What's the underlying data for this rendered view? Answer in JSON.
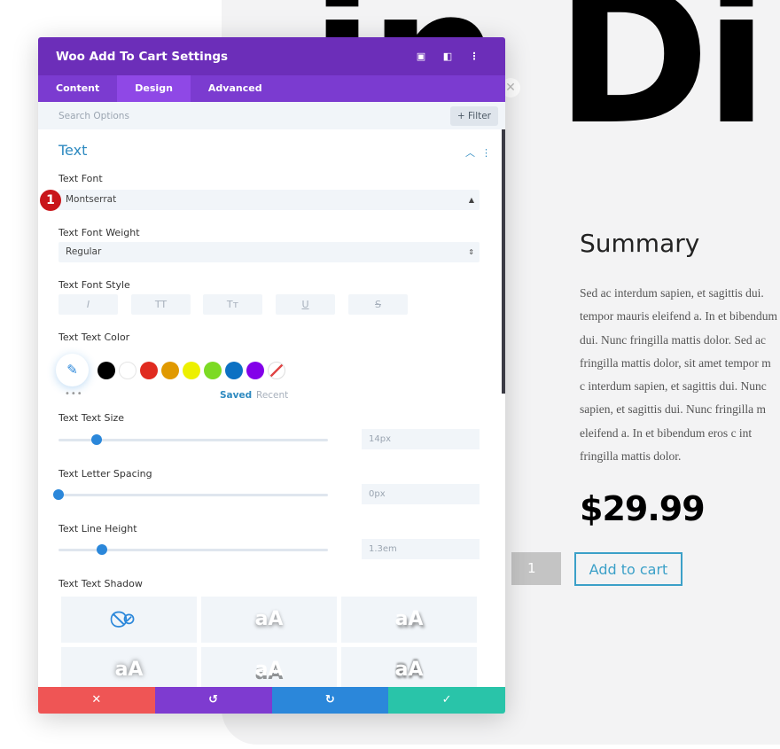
{
  "page": {
    "heading_fragment": "in Di",
    "summary_title": "Summary",
    "description_lines": [
      "Sed ac interdum sapien, et sagittis dui.",
      "tempor mauris eleifend a. In et bibendum",
      "dui. Nunc fringilla mattis dolor. Sed ac",
      "fringilla mattis dolor, sit amet tempor m",
      "c interdum sapien, et sagittis dui. Nunc",
      "sapien, et sagittis dui. Nunc fringilla m",
      "eleifend a. In et bibendum eros c int",
      "fringilla mattis dolor."
    ],
    "price": "$29.99",
    "quantity": "1",
    "add_to_cart": "Add to cart"
  },
  "modal": {
    "title": "Woo Add To Cart Settings",
    "header_icons": [
      "fullscreen-icon",
      "split-view-icon",
      "more-vertical-icon"
    ],
    "tabs": [
      {
        "label": "Content"
      },
      {
        "label": "Design",
        "active": true
      },
      {
        "label": "Advanced"
      }
    ],
    "search_placeholder": "Search Options",
    "filter_label": "+ Filter",
    "section": "Text",
    "text_font": {
      "label": "Text Font",
      "value": "Montserrat",
      "badge": "1"
    },
    "font_weight": {
      "label": "Text Font Weight",
      "value": "Regular"
    },
    "font_style": {
      "label": "Text Font Style",
      "buttons": [
        "I",
        "TT",
        "Tт",
        "U",
        "S"
      ]
    },
    "text_color": {
      "label": "Text Text Color",
      "swatches": [
        "#000000",
        "#ffffff",
        "#e02b20",
        "#e09900",
        "#edf000",
        "#7cda24",
        "#0c71c3",
        "#8300e9"
      ],
      "saved": "Saved",
      "recent": "Recent"
    },
    "text_size": {
      "label": "Text Text Size",
      "value": "14px",
      "percent": 14
    },
    "letter_spacing": {
      "label": "Text Letter Spacing",
      "value": "0px",
      "percent": 0
    },
    "line_height": {
      "label": "Text Line Height",
      "value": "1.3em",
      "percent": 16
    },
    "text_shadow": {
      "label": "Text Text Shadow",
      "options": [
        "none",
        "aA",
        "aA",
        "aA",
        "aA",
        "aA"
      ]
    },
    "footer": {
      "colors": [
        "#ef5555",
        "#7e3bd0",
        "#2b87da",
        "#29c4a9"
      ]
    }
  }
}
